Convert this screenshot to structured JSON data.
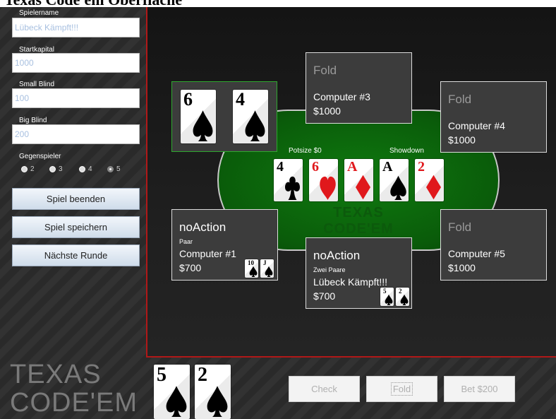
{
  "window": {
    "title": "Texas Code'em Oberfläche"
  },
  "settings": {
    "player_name_label": "Spielername",
    "player_name_value": "Lübeck Kämpft!!!",
    "start_capital_label": "Startkapital",
    "start_capital_value": "1000",
    "small_blind_label": "Small Blind",
    "small_blind_value": "100",
    "big_blind_label": "Big Blind",
    "big_blind_value": "200",
    "opponents_label": "Gegenspieler",
    "opponent_options": [
      "2",
      "3",
      "4",
      "5"
    ],
    "opponent_selected": "5"
  },
  "menu_buttons": {
    "end_game": "Spiel beenden",
    "save_game": "Spiel speichern",
    "next_round": "Nächste Runde"
  },
  "table": {
    "potsize_label": "Potsize $0",
    "stage_label": "Showdown",
    "felt_logo": "TEXAS CODE'EM",
    "community_cards": [
      {
        "rank": "4",
        "suit": "clubs"
      },
      {
        "rank": "6",
        "suit": "hearts"
      },
      {
        "rank": "A",
        "suit": "diamonds"
      },
      {
        "rank": "A",
        "suit": "spades"
      },
      {
        "rank": "2",
        "suit": "diamonds"
      }
    ]
  },
  "highlight_cards": [
    {
      "rank": "6",
      "suit": "spades"
    },
    {
      "rank": "4",
      "suit": "spades"
    }
  ],
  "players": {
    "computer3": {
      "status": "Fold",
      "name": "Computer #3",
      "money": "$1000"
    },
    "computer4": {
      "status": "Fold",
      "name": "Computer #4",
      "money": "$1000"
    },
    "computer5": {
      "status": "Fold",
      "name": "Computer #5",
      "money": "$1000"
    },
    "computer1": {
      "status": "noAction",
      "hand": "Paar",
      "name": "Computer #1",
      "money": "$700",
      "cards": [
        {
          "rank": "10",
          "suit": "spades"
        },
        {
          "rank": "J",
          "suit": "spades"
        }
      ]
    },
    "human": {
      "status": "noAction",
      "hand": "Zwei Paare",
      "name": "Lübeck Kämpft!!!",
      "money": "$700",
      "cards": [
        {
          "rank": "5",
          "suit": "spades"
        },
        {
          "rank": "2",
          "suit": "spades"
        }
      ]
    }
  },
  "own_cards": [
    {
      "rank": "5",
      "suit": "spades"
    },
    {
      "rank": "2",
      "suit": "spades"
    }
  ],
  "logo": {
    "line1": "TEXAS",
    "line2": "CODE'EM"
  },
  "actions": {
    "check": "Check",
    "fold": "Fold",
    "bet": "Bet $200"
  },
  "colors": {
    "felt": "#0a5c0a",
    "red_suit": "#e0181c",
    "black_suit": "#000000",
    "highlight_border": "#2fa82f",
    "game_border": "#b01818"
  }
}
